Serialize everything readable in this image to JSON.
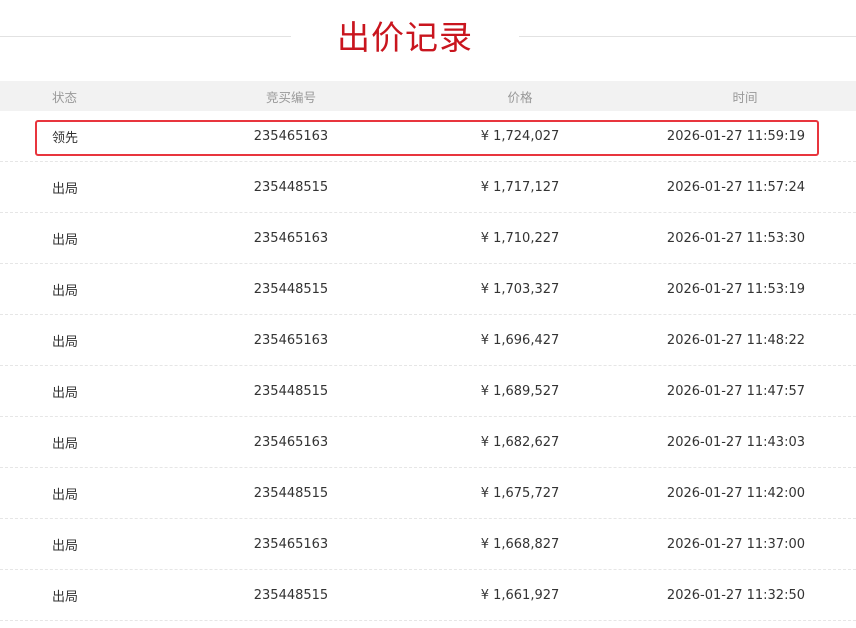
{
  "title": "出价记录",
  "columns": {
    "status": "状态",
    "code": "竞买编号",
    "price": "价格",
    "time": "时间"
  },
  "accent_color": "#c9151e",
  "highlight_color": "#e8353d",
  "rows": [
    {
      "status": "领先",
      "code": "235465163",
      "price": "¥ 1,724,027",
      "time": "2026-01-27 11:59:19",
      "highlighted": true
    },
    {
      "status": "出局",
      "code": "235448515",
      "price": "¥ 1,717,127",
      "time": "2026-01-27 11:57:24"
    },
    {
      "status": "出局",
      "code": "235465163",
      "price": "¥ 1,710,227",
      "time": "2026-01-27 11:53:30"
    },
    {
      "status": "出局",
      "code": "235448515",
      "price": "¥ 1,703,327",
      "time": "2026-01-27 11:53:19"
    },
    {
      "status": "出局",
      "code": "235465163",
      "price": "¥ 1,696,427",
      "time": "2026-01-27 11:48:22"
    },
    {
      "status": "出局",
      "code": "235448515",
      "price": "¥ 1,689,527",
      "time": "2026-01-27 11:47:57"
    },
    {
      "status": "出局",
      "code": "235465163",
      "price": "¥ 1,682,627",
      "time": "2026-01-27 11:43:03"
    },
    {
      "status": "出局",
      "code": "235448515",
      "price": "¥ 1,675,727",
      "time": "2026-01-27 11:42:00"
    },
    {
      "status": "出局",
      "code": "235465163",
      "price": "¥ 1,668,827",
      "time": "2026-01-27 11:37:00"
    },
    {
      "status": "出局",
      "code": "235448515",
      "price": "¥ 1,661,927",
      "time": "2026-01-27 11:32:50"
    }
  ]
}
